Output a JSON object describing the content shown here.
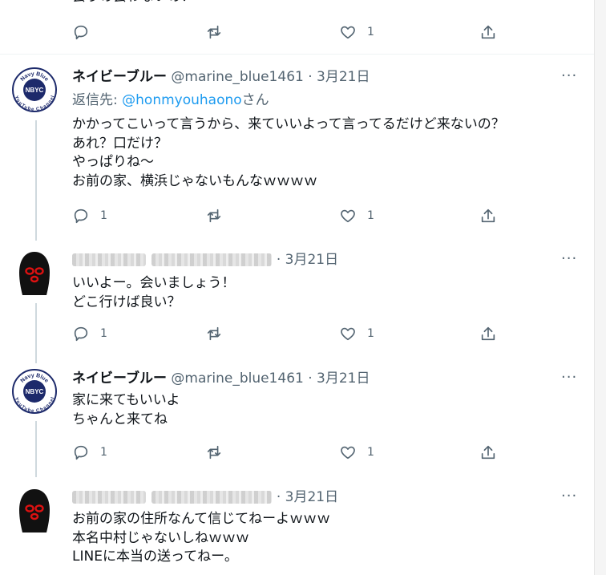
{
  "top_partial": {
    "text": "会うの会わないの？",
    "like_count": "1"
  },
  "tweets": [
    {
      "name": "ネイビーブルー",
      "handle": "@marine_blue1461",
      "sep": "·",
      "date": "3月21日",
      "reply_prefix": "返信先: ",
      "reply_handle": "@honmyouhaono",
      "reply_suffix": "さん",
      "lines": [
        "かかってこいって言うから、来ていいよって言ってるだけど来ないの？",
        "あれ？口だけ？",
        "やっぱりね～",
        "お前の家、横浜じゃないもんなｗｗｗｗ"
      ],
      "reply_count": "1",
      "like_count": "1"
    },
    {
      "sep": "·",
      "date": "3月21日",
      "lines": [
        "いいよー。会いましょう！",
        "どこ行けば良い？"
      ],
      "reply_count": "1",
      "like_count": "1"
    },
    {
      "name": "ネイビーブルー",
      "handle": "@marine_blue1461",
      "sep": "·",
      "date": "3月21日",
      "lines": [
        "家に来てもいいよ",
        "ちゃんと来てね"
      ],
      "reply_count": "1",
      "like_count": "1"
    },
    {
      "sep": "·",
      "date": "3月21日",
      "lines": [
        "お前の家の住所なんて信じてねーよｗｗｗ",
        "本名中村じゃないしねｗｗｗ",
        "LINEに本当の送ってねー。"
      ]
    }
  ],
  "avatar_text": {
    "top": "Navy Blue",
    "bottom": "YouTube Channel",
    "center": "NBYC"
  },
  "more_label": "···",
  "icons": [
    "reply-icon",
    "retweet-icon",
    "like-icon",
    "share-icon",
    "more-icon",
    "navy-blue-logo",
    "balaclava-avatar"
  ],
  "colors": {
    "link": "#1d9bf0",
    "muted": "#536471",
    "text": "#0f1419",
    "line": "#cfd9de"
  }
}
